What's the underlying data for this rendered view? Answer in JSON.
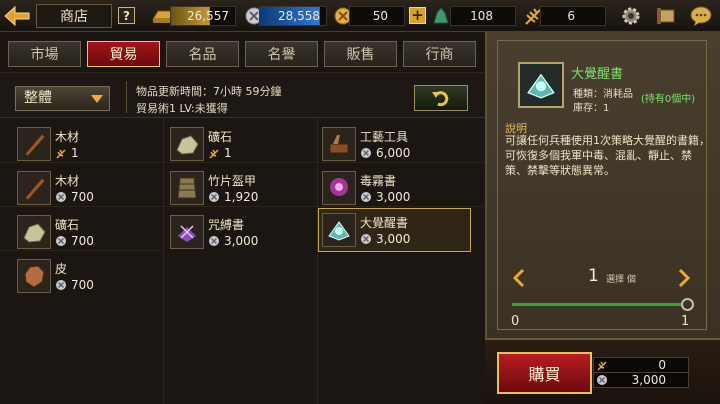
{
  "header": {
    "title": "商店",
    "help_label": "?",
    "resources": [
      {
        "name": "gold-ingot",
        "value": "26,557"
      },
      {
        "name": "silver-coin",
        "value": "28,558"
      },
      {
        "name": "gold-coin",
        "value": "50"
      },
      {
        "name": "jade",
        "value": "108"
      },
      {
        "name": "wheat",
        "value": "6"
      }
    ],
    "plus_label": "+"
  },
  "tabs": [
    "市場",
    "貿易",
    "名品",
    "名譽",
    "販售",
    "行商"
  ],
  "active_tab": "貿易",
  "filter": {
    "dropdown_value": "整體",
    "update_text": "物品更新時間：7小時 59分鐘",
    "skill_text": "貿易術1 LV:未獲得"
  },
  "items": [
    {
      "name": "木材",
      "currency": "wheat",
      "price": "1"
    },
    {
      "name": "礦石",
      "currency": "wheat",
      "price": "1"
    },
    {
      "name": "工藝工具",
      "currency": "silver",
      "price": "6,000"
    },
    {
      "name": "木材",
      "currency": "silver",
      "price": "700"
    },
    {
      "name": "竹片盔甲",
      "currency": "silver",
      "price": "1,920"
    },
    {
      "name": "毒霧書",
      "currency": "silver",
      "price": "3,000"
    },
    {
      "name": "礦石",
      "currency": "silver",
      "price": "700"
    },
    {
      "name": "咒縛書",
      "currency": "silver",
      "price": "3,000"
    },
    {
      "name": "大覺醒書",
      "currency": "silver",
      "price": "3,000"
    },
    {
      "name": "皮",
      "currency": "silver",
      "price": "700"
    }
  ],
  "detail": {
    "name": "大覺醒書",
    "type": "種類：消耗品",
    "stock": "庫存：1",
    "owned": "(持有0個中)",
    "desc_title": "說明",
    "desc": "可讓任何兵種使用1次策略大覺醒的書籍，可恢復多個我軍中毒、混亂、靜止、禁策、禁擊等狀態異常。",
    "quantity": "1",
    "quantity_label": "選擇 個",
    "slider_min": "0",
    "slider_max": "1",
    "slider_fraction": 1.0
  },
  "buy": {
    "label": "購買",
    "cost_wheat": "0",
    "cost_silver": "3,000"
  },
  "colors": {
    "accent_red": "#a4141a",
    "gold_border": "#e9c66b",
    "highlight_green": "#7fe06a"
  }
}
